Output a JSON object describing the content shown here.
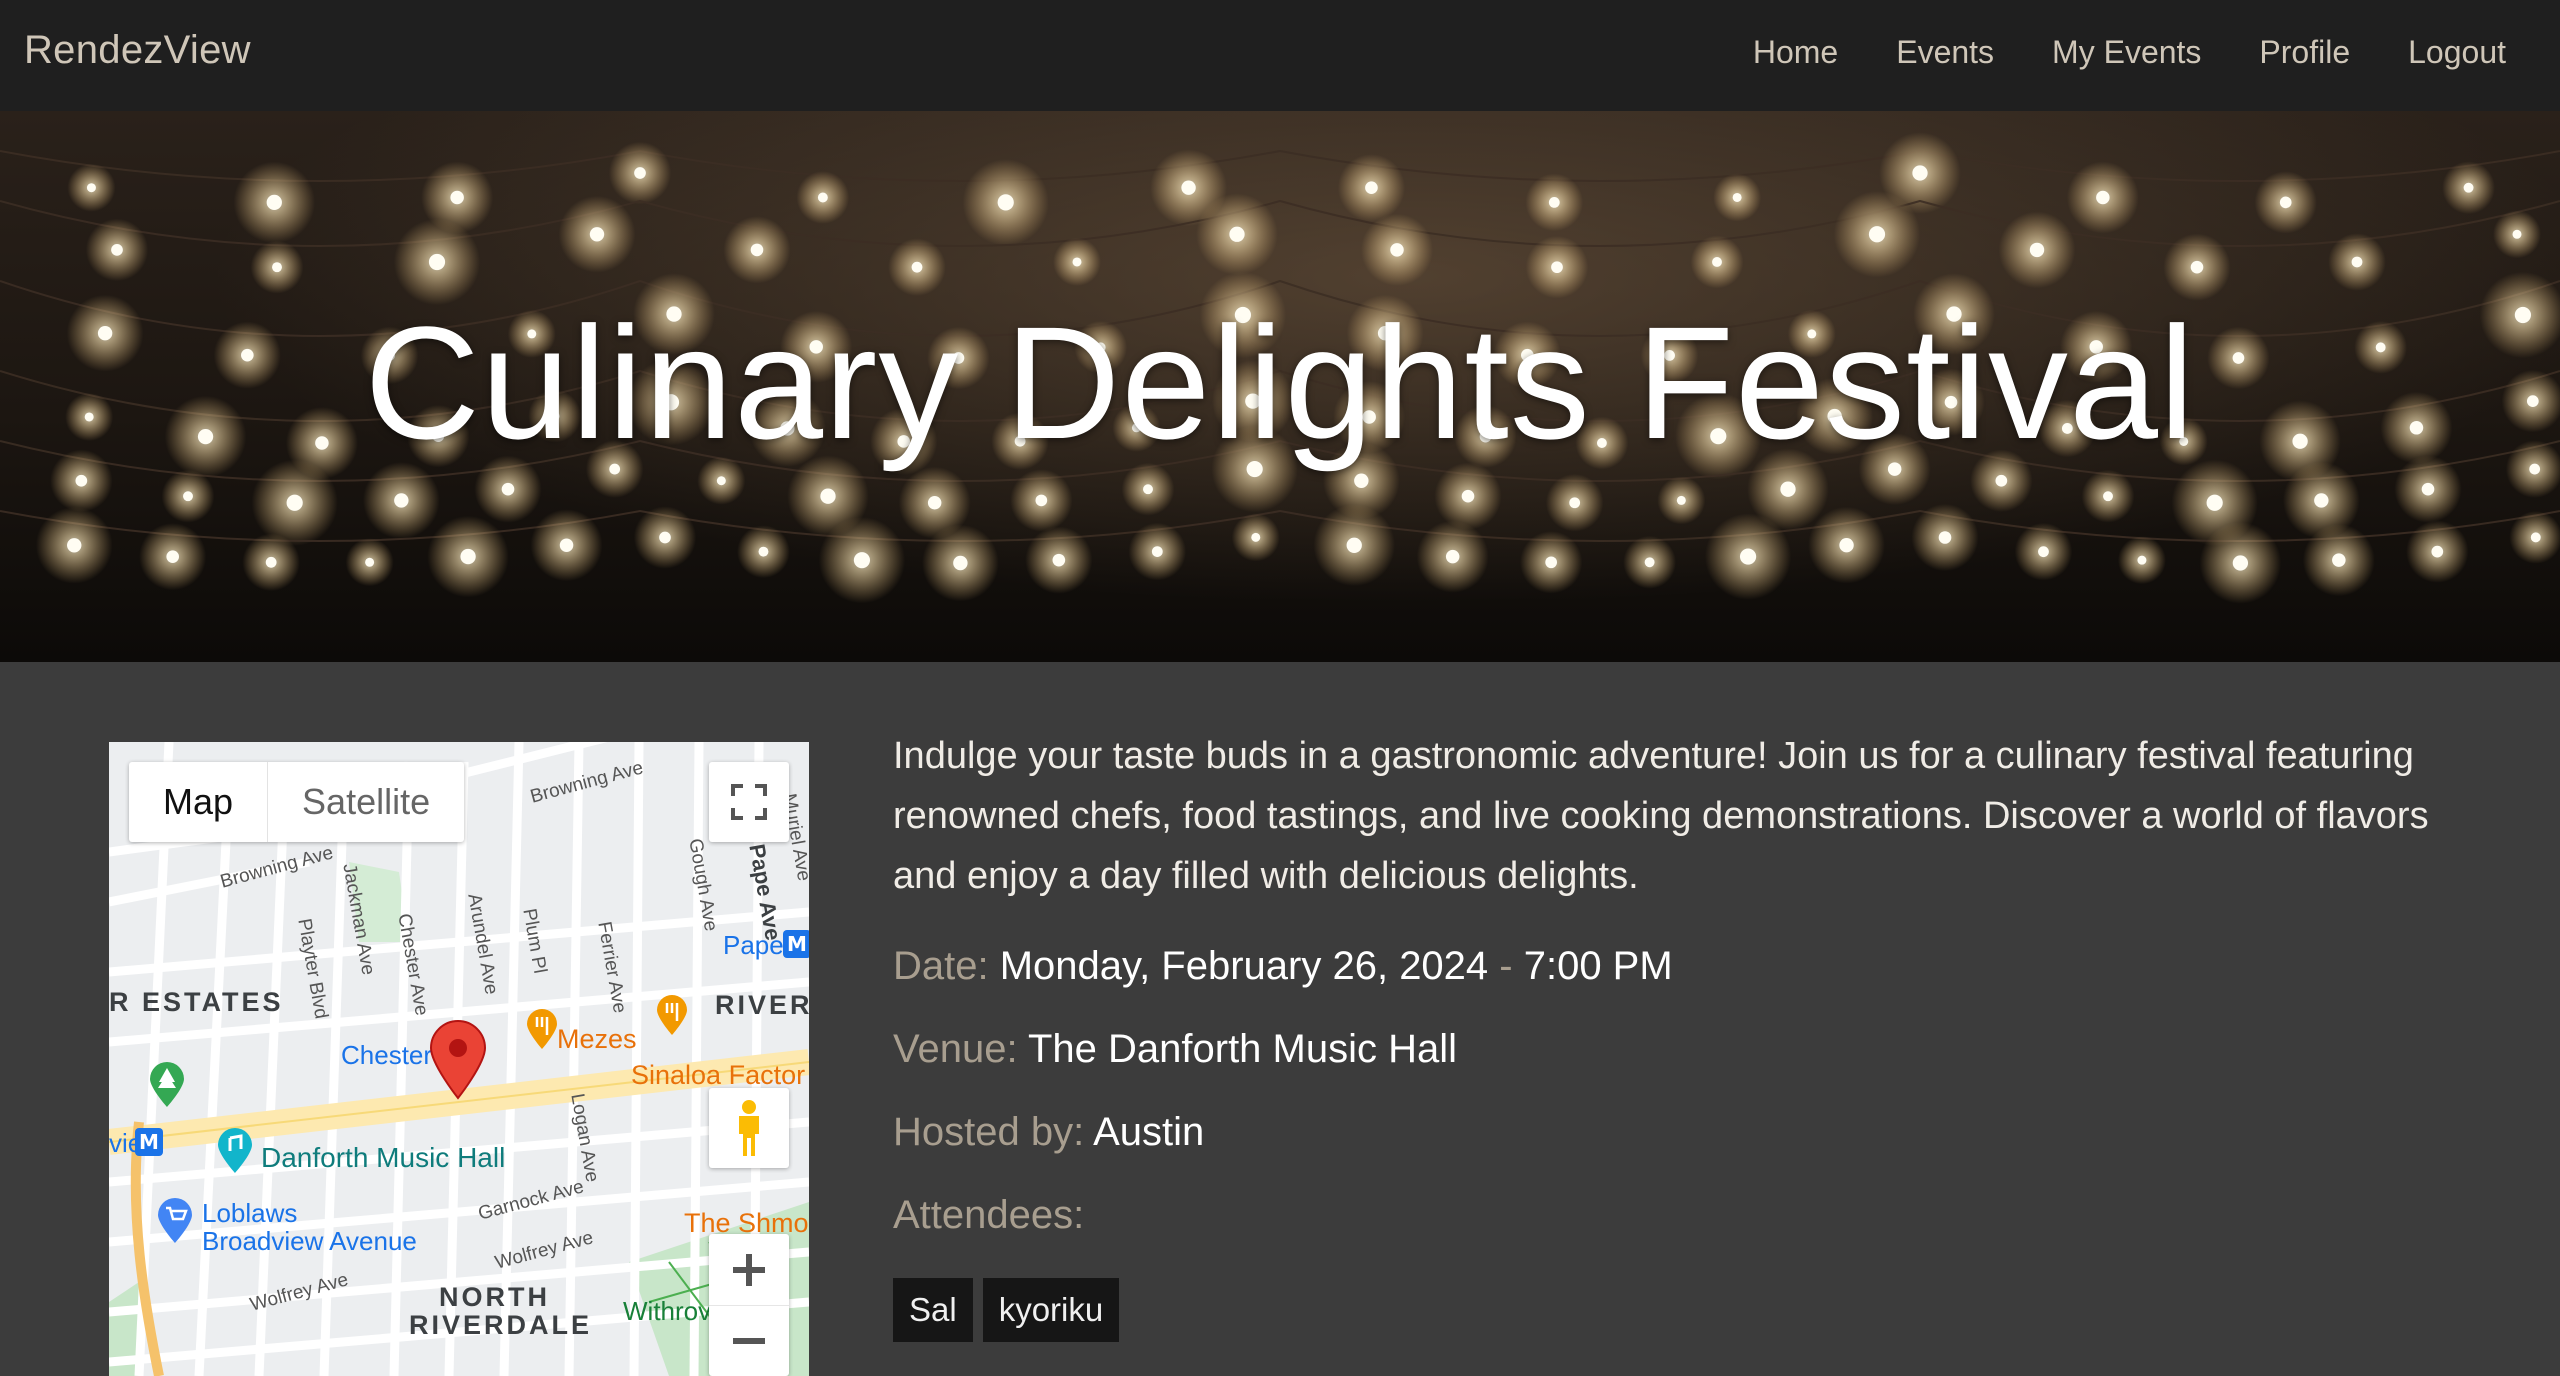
{
  "navbar": {
    "brand": "RendezView",
    "links": [
      "Home",
      "Events",
      "My Events",
      "Profile",
      "Logout"
    ]
  },
  "hero": {
    "title": "Culinary Delights Festival"
  },
  "map": {
    "type_controls": {
      "map": "Map",
      "satellite": "Satellite"
    },
    "labels": {
      "browning_ave_top": "Browning Ave",
      "browning_ave_left": "Browning Ave",
      "jackman_ave": "Jackman Ave",
      "playter_blvd": "Playter Blvd",
      "chester_ave": "Chester Ave",
      "arundel_ave": "Arundel Ave",
      "plum_pl": "Plum Pl",
      "ferrier_ave": "Ferrier Ave",
      "gough_ave": "Gough Ave",
      "pape_ave": "Pape Ave",
      "muriel_ave": "Muriel Ave",
      "estates": "R ESTATES",
      "river": "RIVER",
      "pape_station": "Pape",
      "chester_station": "Chester",
      "mezes": "Mezes",
      "sinaloa": "Sinaloa Factor",
      "broadview_station": "view",
      "danforth_music_hall": "Danforth Music Hall",
      "logan_ave": "Logan Ave",
      "garnock_ave": "Garnock Ave",
      "loblaws": "Loblaws",
      "loblaws_sub": "Broadview Avenue",
      "wolfrey_ave_right": "Wolfrey Ave",
      "wolfrey_ave_left": "Wolfrey Ave",
      "the_shmo": "The Shmo",
      "north": "NORTH",
      "riverdale": "RIVERDALE",
      "withrow": "Withrov"
    }
  },
  "event": {
    "description": "Indulge your taste buds in a gastronomic adventure! Join us for a culinary festival featuring renowned chefs, food tastings, and live cooking demonstrations. Discover a world of flavors and enjoy a day filled with delicious delights.",
    "date_label": "Date:",
    "date_value": "Monday, February 26, 2024",
    "time_sep": " - ",
    "time_value": "7:00 PM",
    "venue_label": "Venue:",
    "venue_value": "The Danforth Music Hall",
    "host_label": "Hosted by:",
    "host_value": "Austin",
    "attendees_label": "Attendees:",
    "attendees": [
      "Sal",
      "kyoriku"
    ]
  },
  "colors": {
    "navbar_bg": "#1f1f1f",
    "page_bg": "#3c3c3c",
    "label_muted": "#a89e8f",
    "pin_red": "#ea4335"
  }
}
